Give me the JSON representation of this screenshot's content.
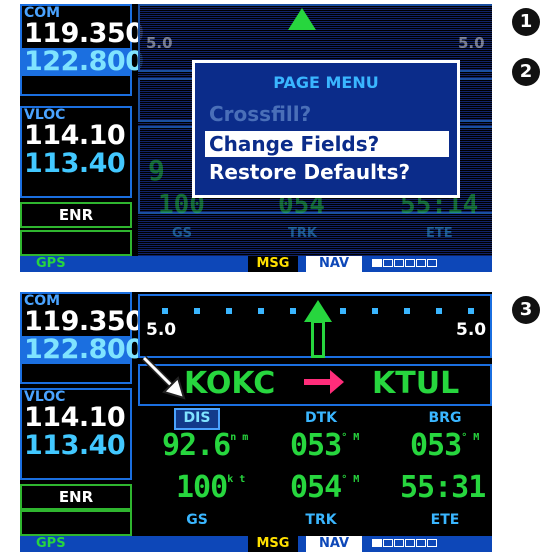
{
  "callouts": [
    "1",
    "2",
    "3"
  ],
  "left_panel": {
    "com_label": "COM",
    "com_active": "119.350",
    "com_standby": "122.800",
    "vloc_label": "VLOC",
    "vloc_active": "114.10",
    "vloc_standby": "113.40",
    "mode": "ENR"
  },
  "cdi": {
    "scale_left": "5.0",
    "scale_right": "5.0"
  },
  "route": {
    "from": "KOKC",
    "to": "KTUL"
  },
  "fields": {
    "top_labels": [
      "DIS",
      "DTK",
      "BRG"
    ],
    "top_values": [
      {
        "value": "92.6",
        "unit": "n m"
      },
      {
        "value": "053",
        "unit": "° M"
      },
      {
        "value": "053",
        "unit": "° M"
      }
    ],
    "bottom_values": [
      {
        "value": "100",
        "unit": "k t"
      },
      {
        "value": "054",
        "unit": "° M"
      },
      {
        "value": "55:31",
        "unit": ""
      }
    ],
    "bottom_labels": [
      "GS",
      "TRK",
      "ETE"
    ]
  },
  "faded": {
    "values": [
      "100",
      "054",
      "55:14"
    ],
    "labels": [
      "GS",
      "TRK",
      "ETE"
    ],
    "left_value": "9"
  },
  "popup": {
    "title": "PAGE MENU",
    "items": [
      "Crossfill?",
      "Change Fields?",
      "Restore Defaults?"
    ],
    "selected_index": 1
  },
  "status": {
    "gps": "GPS",
    "msg": "MSG",
    "nav": "NAV",
    "cells_filled": 1,
    "cells_total": 6
  },
  "colors": {
    "green": "#27d63e",
    "blue": "#1b6fe0",
    "cyan": "#3ab6ff",
    "status_bg": "#0d47b8"
  }
}
